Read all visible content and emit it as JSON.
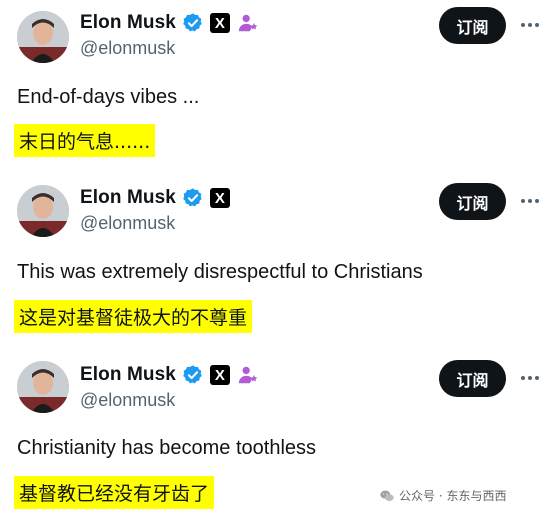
{
  "posts": [
    {
      "name": "Elon Musk",
      "handle": "@elonmusk",
      "follow_label": "订阅",
      "text": "End-of-days vibes ...",
      "translation": "末日的气息......",
      "has_affiliate_icon": true
    },
    {
      "name": "Elon Musk",
      "handle": "@elonmusk",
      "follow_label": "订阅",
      "text": "This was extremely disrespectful to Christians",
      "translation": "这是对基督徒极大的不尊重",
      "has_affiliate_icon": false
    },
    {
      "name": "Elon Musk",
      "handle": "@elonmusk",
      "follow_label": "订阅",
      "text": "Christianity has become toothless",
      "translation": "基督教已经没有牙齿了",
      "has_affiliate_icon": true
    }
  ],
  "badges": {
    "x_label": "X",
    "verified_color": "#1d9bf0",
    "affiliate_color": "#b05cd6"
  },
  "watermark": {
    "text": "公众号 · 东东与西西"
  },
  "icons": {
    "verified": "verified-badge-icon",
    "x": "x-logo-icon",
    "affiliate": "affiliate-person-icon",
    "more": "more-options-icon",
    "wechat": "wechat-icon"
  }
}
